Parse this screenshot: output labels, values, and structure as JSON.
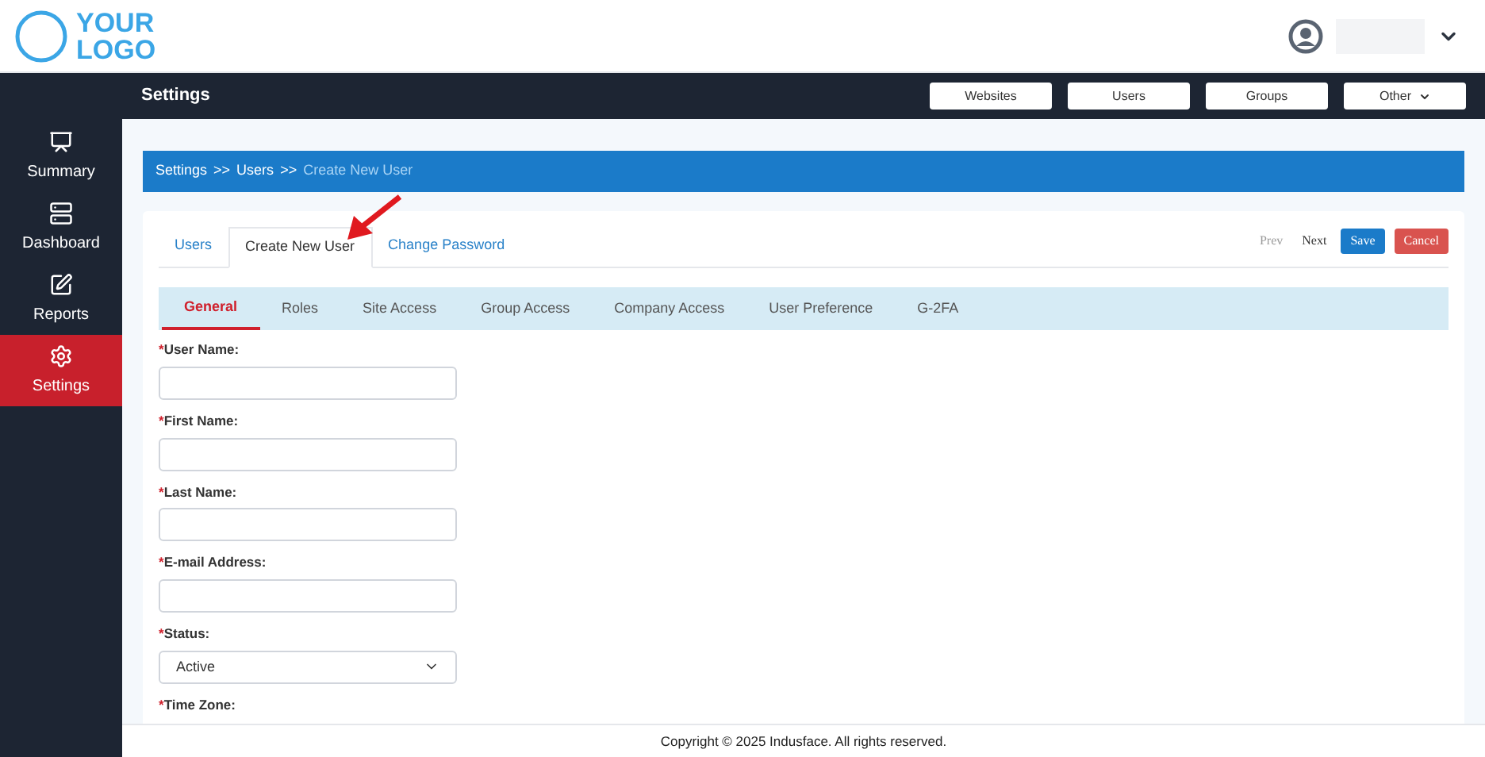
{
  "logo": {
    "line1": "YOUR",
    "line2": "LOGO"
  },
  "page_title": "Settings",
  "top_buttons": [
    {
      "label": "Websites",
      "kind": "plain"
    },
    {
      "label": "Users",
      "kind": "plain"
    },
    {
      "label": "Groups",
      "kind": "plain"
    },
    {
      "label": "Other",
      "kind": "dropdown"
    }
  ],
  "sidebar": {
    "items": [
      {
        "label": "Summary",
        "selected": false
      },
      {
        "label": "Dashboard",
        "selected": false
      },
      {
        "label": "Reports",
        "selected": false
      },
      {
        "label": "Settings",
        "selected": true
      }
    ]
  },
  "breadcrumb": [
    {
      "label": "Settings",
      "current": false
    },
    {
      "label": ">>",
      "current": false
    },
    {
      "label": "Users",
      "current": false
    },
    {
      "label": ">>",
      "current": false
    },
    {
      "label": "Create New User",
      "current": true
    }
  ],
  "tabs": [
    {
      "label": "Users",
      "selected": false
    },
    {
      "label": "Create New User",
      "selected": true
    },
    {
      "label": "Change Password",
      "selected": false
    }
  ],
  "actions": [
    {
      "label": "Prev",
      "kind": "link",
      "disabled": true
    },
    {
      "label": "Next",
      "kind": "link",
      "disabled": false
    },
    {
      "label": "Save",
      "kind": "primary"
    },
    {
      "label": "Cancel",
      "kind": "danger"
    }
  ],
  "subtabs": [
    {
      "label": "General",
      "selected": true
    },
    {
      "label": "Roles",
      "selected": false
    },
    {
      "label": "Site Access",
      "selected": false
    },
    {
      "label": "Group Access",
      "selected": false
    },
    {
      "label": "Company Access",
      "selected": false
    },
    {
      "label": "User Preference",
      "selected": false
    },
    {
      "label": "G-2FA",
      "selected": false
    }
  ],
  "fields": [
    {
      "mark": "*",
      "label": "User Name:",
      "kind": "text"
    },
    {
      "mark": "*",
      "label": "First Name:",
      "kind": "text"
    },
    {
      "mark": "*",
      "label": "Last Name:",
      "kind": "text"
    },
    {
      "mark": "*",
      "label": "E-mail Address:",
      "kind": "text"
    },
    {
      "mark": "*",
      "label": "Status:",
      "kind": "select",
      "value": "Active"
    },
    {
      "mark": "*",
      "label": "Time Zone:",
      "kind": "label"
    }
  ],
  "footer": "Copyright © 2025 Indusface. All rights reserved."
}
